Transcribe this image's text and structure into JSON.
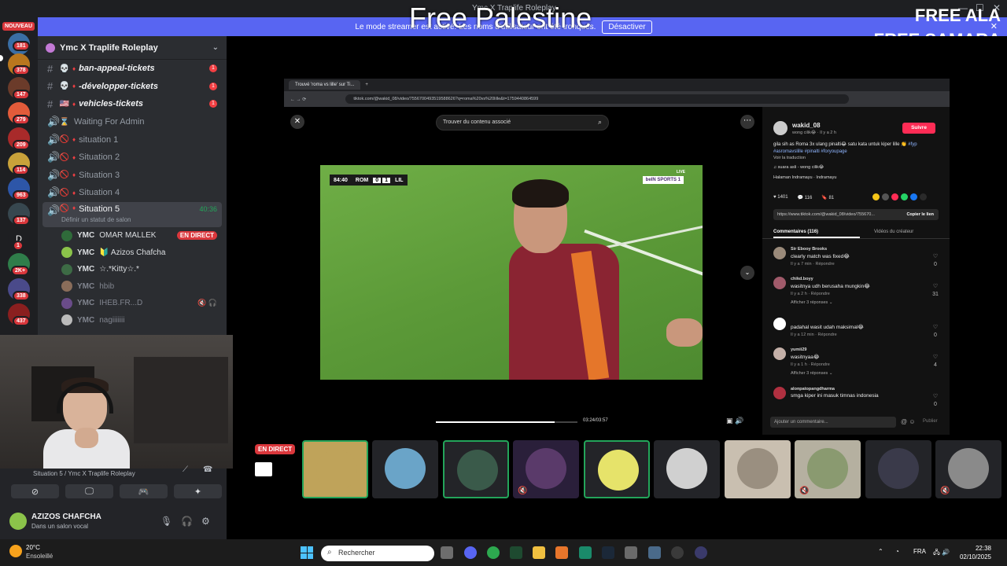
{
  "window": {
    "title": "Ymc X Traplife Roleplay",
    "overlay_title": "Free Palestine",
    "overlay_right": [
      "FREE ALA",
      "FREE SAMARA"
    ]
  },
  "streamer_mode": {
    "message": "Le mode streamer est activé. Les noms d'utilisateur ont été tronqués.",
    "button": "Désactiver"
  },
  "rail": {
    "nouveau": "NOUVEAU",
    "badges": [
      "181",
      "378",
      "147",
      "279",
      "209",
      "114",
      "963",
      "137",
      "1",
      "2K+",
      "338",
      "437"
    ],
    "letter": "D"
  },
  "guild": {
    "name": "Ymc X Traplife Roleplay"
  },
  "channels": [
    {
      "type": "text",
      "emoji": "💀",
      "name": "ban-appeal-tickets",
      "unread": "1"
    },
    {
      "type": "text",
      "emoji": "💀",
      "name": "-développer-tickets",
      "unread": "1"
    },
    {
      "type": "text",
      "emoji": "🇺🇸",
      "name": "vehicles-tickets",
      "unread": "1"
    },
    {
      "type": "voice",
      "emoji": "⌛",
      "name": "Waiting For Admin"
    },
    {
      "type": "voice",
      "emoji": "🚫",
      "name": "situation 1"
    },
    {
      "type": "voice",
      "emoji": "🚫",
      "name": "Situation 2"
    },
    {
      "type": "voice",
      "emoji": "🚫",
      "name": "Situation 3"
    },
    {
      "type": "voice",
      "emoji": "🚫",
      "name": "Situation 4"
    }
  ],
  "active_channel": {
    "name": "Situation 5",
    "timer": "40:36",
    "status_placeholder": "Définir un statut de salon"
  },
  "members": [
    {
      "tag": "YMC",
      "name": "OMAR MALLEK",
      "live": "EN DIRECT",
      "color": "#2f6b3a"
    },
    {
      "tag": "YMC",
      "name": "🔰 Azizos Chafcha",
      "color": "#8bc34a"
    },
    {
      "tag": "YMC",
      "name": "☆.*Kitty☆.*",
      "color": "#3d6b45"
    },
    {
      "tag": "YMC",
      "name": "hbib",
      "dim": true,
      "color": "#8a6d5a"
    },
    {
      "tag": "YMC",
      "name": "IHEB.FR...D",
      "dim": true,
      "icons": "🔇 🎧",
      "color": "#6a4c8a"
    },
    {
      "tag": "YMC",
      "name": "nagiiiiiii",
      "dim": true,
      "color": "#bbbbbb"
    }
  ],
  "voice_panel": {
    "connection": "Situation 5 / Ymc X Traplife Roleplay",
    "user": "AZIZOS CHAFCHA",
    "status": "Dans un salon vocal"
  },
  "browser": {
    "tab_title": "Trouvé 'roma vs lille' sur Ti...",
    "url": "tiktok.com/@wakid_08/video/7556700493519588626?q=roma%20vs%20lille&t=1759440864599"
  },
  "tiktok": {
    "search_placeholder": "Trouver du contenu associé",
    "scoreboard": {
      "time": "84:40",
      "home": "ROM",
      "home_score": "0",
      "away_score": "1",
      "away": "LIL"
    },
    "broadcaster": "beIN SPORTS 1",
    "live_label": "LIVE",
    "time": "03:24/03:57",
    "progress": 0.84,
    "author": "wakid_08",
    "author_meta": "wong cilik😂 · Il y a 2 h",
    "follow": "Suivre",
    "description": "gila sih as Roma 3x ulang pinalti😂 satu kata untuk kiper lille 👏",
    "hashtags": "#fyp #asromavslille #pinalti #foryoupage",
    "translation": "Voir la traduction",
    "sound": "♫ suara asli - wong cilik😂",
    "location": "Halaman Indramayu · Indramayu",
    "stats": {
      "likes": "1401",
      "comments": "116",
      "saves": "81"
    },
    "link": "https://www.tiktok.com/@wakid_08/video/755670...",
    "copy_link": "Copier le lien",
    "tab_comments": "Commentaires (116)",
    "tab_creator": "Vidéos du créateur",
    "comments": [
      {
        "user": "Sir Ebooy Brooks",
        "text": "clearly match was fixed😂",
        "meta": "Il y a 7 min · Répondre",
        "likes": "0"
      },
      {
        "user": "chikd.boyy",
        "text": "wasitnya udh berusaha mungkin😂",
        "meta": "Il y a 2 h · Répondre",
        "likes": "31",
        "more": "Afficher 3 réponses ⌄"
      },
      {
        "user": "",
        "text": "padahal wasit udah maksimal😂",
        "meta": "Il y a 12 min · Répondre",
        "likes": "0"
      },
      {
        "user": "yumii29",
        "text": "wasitnyaa😂",
        "meta": "Il y a 1 h · Répondre",
        "likes": "4",
        "more": "Afficher 3 réponses ⌄"
      },
      {
        "user": "alonpatopangdharma",
        "text": "smga kiper ini masuk timnas indonesia",
        "meta": "",
        "likes": "0"
      }
    ],
    "add_comment": "Ajouter un commentaire...",
    "post": "Publier"
  },
  "stream_tiles": {
    "live_label": "EN DIRECT"
  },
  "taskbar": {
    "temp": "20°C",
    "weather": "Ensoleillé",
    "search": "Rechercher",
    "lang": "FRA",
    "time": "22:38",
    "date": "02/10/2025"
  }
}
